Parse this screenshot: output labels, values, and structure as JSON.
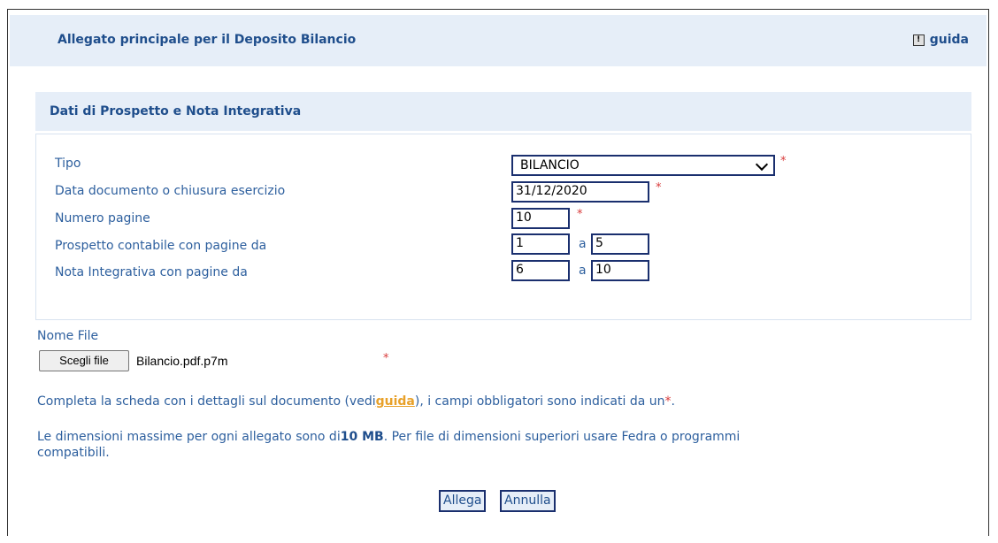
{
  "header": {
    "title": "Allegato principale per il Deposito Bilancio",
    "guida": "guida"
  },
  "section": {
    "title": "Dati di Prospetto e Nota Integrativa"
  },
  "form": {
    "tipo_label": "Tipo",
    "tipo_value": "BILANCIO",
    "data_label": "Data documento o chiusura esercizio",
    "data_value": "31/12/2020",
    "pagine_label": "Numero pagine",
    "pagine_value": "10",
    "prospetto_label": "Prospetto contabile con pagine da",
    "prospetto_from": "1",
    "prospetto_to": "5",
    "nota_label": "Nota Integrativa con pagine da",
    "nota_from": "6",
    "nota_to": "10",
    "sep": "a",
    "required_mark": "*"
  },
  "file": {
    "label": "Nome File",
    "button": "Scegli file",
    "name": "Bilancio.pdf.p7m"
  },
  "info": {
    "line1_pre": "Completa la scheda con i dettagli sul documento (vedi",
    "line1_link": "guida",
    "line1_mid": "), i campi obbligatori sono indicati da un",
    "line1_star": "*",
    "line1_end": ".",
    "line2_pre": "Le dimensioni massime per ogni allegato sono di",
    "line2_bold": "10 MB",
    "line2_post": ". Per file di dimensioni superiori usare Fedra o programmi",
    "line3": "compatibili."
  },
  "actions": {
    "allega": "Allega",
    "annulla": "Annulla"
  }
}
